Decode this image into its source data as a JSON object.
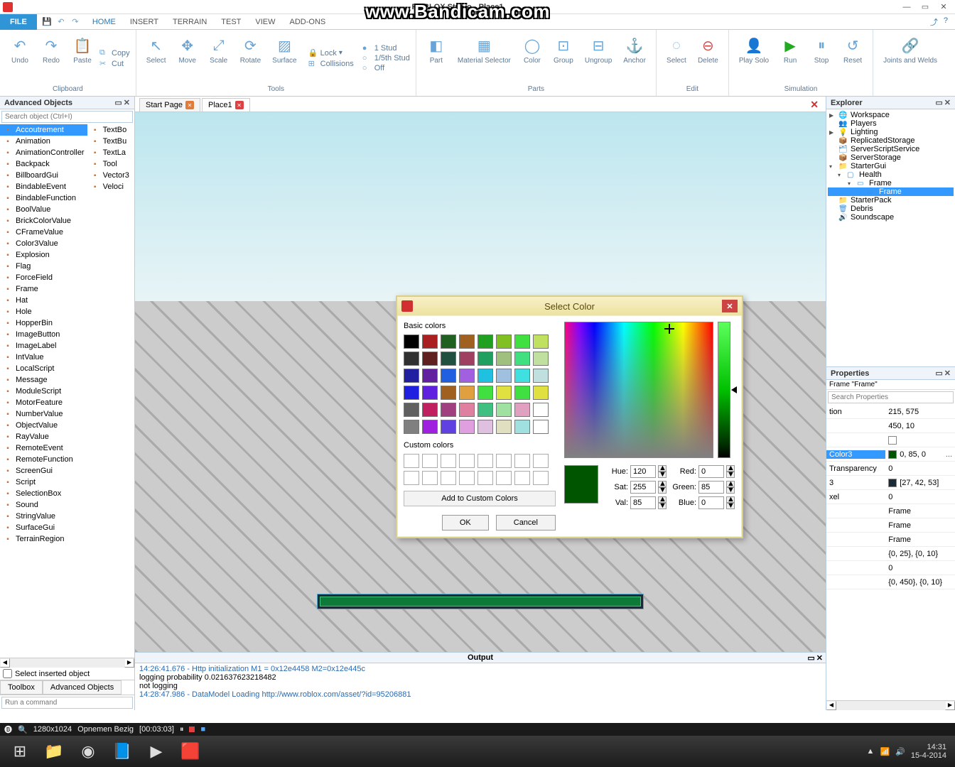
{
  "watermark": "www.Bandicam.com",
  "window": {
    "title": "ROBLOX Studio - Place1"
  },
  "menubar": {
    "file": "FILE",
    "items": [
      "HOME",
      "INSERT",
      "TERRAIN",
      "TEST",
      "VIEW",
      "ADD-ONS"
    ],
    "active": 0
  },
  "ribbon": {
    "clipboard": {
      "undo": "Undo",
      "redo": "Redo",
      "paste": "Paste",
      "copy": "Copy",
      "cut": "Cut",
      "label": "Clipboard"
    },
    "tools": {
      "select": "Select",
      "move": "Move",
      "scale": "Scale",
      "rotate": "Rotate",
      "surface": "Surface",
      "lock": "Lock",
      "collisions": "Collisions",
      "stud1": "1 Stud",
      "stud15": "1/5th Stud",
      "off": "Off",
      "label": "Tools"
    },
    "parts": {
      "part": "Part",
      "material": "Material Selector",
      "color": "Color",
      "group": "Group",
      "ungroup": "Ungroup",
      "anchor": "Anchor",
      "label": "Parts"
    },
    "edit": {
      "select": "Select",
      "delete": "Delete",
      "label": "Edit"
    },
    "sim": {
      "play": "Play Solo",
      "run": "Run",
      "stop": "Stop",
      "reset": "Reset",
      "label": "Simulation"
    },
    "joints": {
      "joints": "Joints and Welds",
      "label": ""
    }
  },
  "doctabs": {
    "start": "Start Page",
    "place": "Place1"
  },
  "advanced": {
    "title": "Advanced Objects",
    "search_placeholder": "Search object (Ctrl+I)",
    "col1": [
      "Accoutrement",
      "Animation",
      "AnimationController",
      "Backpack",
      "BillboardGui",
      "BindableEvent",
      "BindableFunction",
      "BoolValue",
      "BrickColorValue",
      "CFrameValue",
      "Color3Value",
      "Explosion",
      "Flag",
      "ForceField",
      "Frame",
      "Hat",
      "Hole",
      "HopperBin",
      "ImageButton",
      "ImageLabel",
      "IntValue",
      "LocalScript",
      "Message",
      "ModuleScript",
      "MotorFeature",
      "NumberValue",
      "ObjectValue",
      "RayValue",
      "RemoteEvent",
      "RemoteFunction",
      "ScreenGui",
      "Script",
      "SelectionBox",
      "Sound",
      "StringValue",
      "SurfaceGui",
      "TerrainRegion"
    ],
    "col2": [
      "TextBo",
      "TextBu",
      "TextLa",
      "Tool",
      "Vector3",
      "Veloci"
    ],
    "select_inserted": "Select inserted object",
    "tabs": [
      "Toolbox",
      "Advanced Objects"
    ],
    "cmd_placeholder": "Run a command"
  },
  "explorer": {
    "title": "Explorer",
    "items": [
      {
        "exp": "▶",
        "icon": "🌐",
        "name": "Workspace",
        "ind": 0
      },
      {
        "exp": "",
        "icon": "👥",
        "name": "Players",
        "ind": 0
      },
      {
        "exp": "▶",
        "icon": "💡",
        "name": "Lighting",
        "ind": 0
      },
      {
        "exp": "",
        "icon": "📦",
        "name": "ReplicatedStorage",
        "ind": 0
      },
      {
        "exp": "",
        "icon": "🗂",
        "name": "ServerScriptService",
        "ind": 0
      },
      {
        "exp": "",
        "icon": "📦",
        "name": "ServerStorage",
        "ind": 0
      },
      {
        "exp": "▾",
        "icon": "📁",
        "name": "StarterGui",
        "ind": 0
      },
      {
        "exp": "▾",
        "icon": "▢",
        "name": "Health",
        "ind": 1
      },
      {
        "exp": "▾",
        "icon": "▭",
        "name": "Frame",
        "ind": 2
      },
      {
        "exp": "",
        "icon": "▭",
        "name": "Frame",
        "ind": 3,
        "sel": true
      },
      {
        "exp": "",
        "icon": "📁",
        "name": "StarterPack",
        "ind": 0
      },
      {
        "exp": "",
        "icon": "🗑",
        "name": "Debris",
        "ind": 0
      },
      {
        "exp": "",
        "icon": "🔊",
        "name": "Soundscape",
        "ind": 0
      }
    ]
  },
  "properties": {
    "title": "Properties",
    "subtitle": "Frame \"Frame\"",
    "search_placeholder": "Search Properties",
    "rows": [
      {
        "name": "tion",
        "value": "215, 575"
      },
      {
        "name": "",
        "value": "450, 10"
      },
      {
        "name": "",
        "value": "",
        "swatch": "#ffffff"
      },
      {
        "name": "Color3",
        "value": "0, 85, 0",
        "swatch": "#005500",
        "sel": true,
        "dots": "..."
      },
      {
        "name": "Transparency",
        "value": "0"
      },
      {
        "name": "3",
        "value": "[27, 42, 53]",
        "swatch": "#1b2a35"
      },
      {
        "name": "xel",
        "value": "0"
      },
      {
        "name": "",
        "value": "Frame"
      },
      {
        "name": "",
        "value": "Frame"
      },
      {
        "name": "",
        "value": "Frame"
      },
      {
        "name": "",
        "value": "{0, 25}, {0, 10}"
      },
      {
        "name": "",
        "value": "0"
      },
      {
        "name": "",
        "value": "{0, 450}, {0, 10}"
      }
    ]
  },
  "output": {
    "title": "Output",
    "lines": [
      {
        "t": "14:26:41.676 - Http initialization M1 = 0x12e4458 M2=0x12e445c",
        "blue": true
      },
      {
        "t": "logging probability 0.021637623218482"
      },
      {
        "t": "not logging"
      },
      {
        "t": "14:28:47.986 - DataModel Loading http://www.roblox.com/asset/?id=95206881",
        "blue": true
      }
    ]
  },
  "dialog": {
    "title": "Select Color",
    "basic_label": "Basic colors",
    "custom_label": "Custom colors",
    "add_custom": "Add to Custom Colors",
    "basic_colors": [
      "#000000",
      "#aa2020",
      "#206020",
      "#a06020",
      "#20a020",
      "#80c020",
      "#40e040",
      "#c0e060",
      "#303030",
      "#602020",
      "#205040",
      "#a04060",
      "#20a060",
      "#a0c080",
      "#40e080",
      "#c0e0a0",
      "#2020a0",
      "#6020a0",
      "#2060e0",
      "#a060e0",
      "#20c0e0",
      "#a0c0e0",
      "#40e0e0",
      "#c0e0e0",
      "#2020e0",
      "#6020e0",
      "#a06020",
      "#e0a040",
      "#40e040",
      "#e0e040",
      "#40e040",
      "#e0e040",
      "#606060",
      "#c02060",
      "#a04080",
      "#e080a0",
      "#40c080",
      "#a0e0a0",
      "#e0a0c0",
      "#ffffff",
      "#808080",
      "#a020e0",
      "#6040e0",
      "#e0a0e0",
      "#e0c0e0",
      "#e0e0c0",
      "#a0e0e0",
      "#ffffff"
    ],
    "hue": {
      "label": "Hue:",
      "val": "120"
    },
    "sat": {
      "label": "Sat:",
      "val": "255"
    },
    "val": {
      "label": "Val:",
      "val": "85"
    },
    "red": {
      "label": "Red:",
      "val": "0"
    },
    "green": {
      "label": "Green:",
      "val": "85"
    },
    "blue": {
      "label": "Blue:",
      "val": "0"
    },
    "ok": "OK",
    "cancel": "Cancel",
    "preview": "#005500"
  },
  "recorder": {
    "res": "1280x1024",
    "status": "Opnemen Bezig",
    "time": "[00:03:03]"
  },
  "taskbar": {
    "time": "14:31",
    "date": "15-4-2014"
  }
}
